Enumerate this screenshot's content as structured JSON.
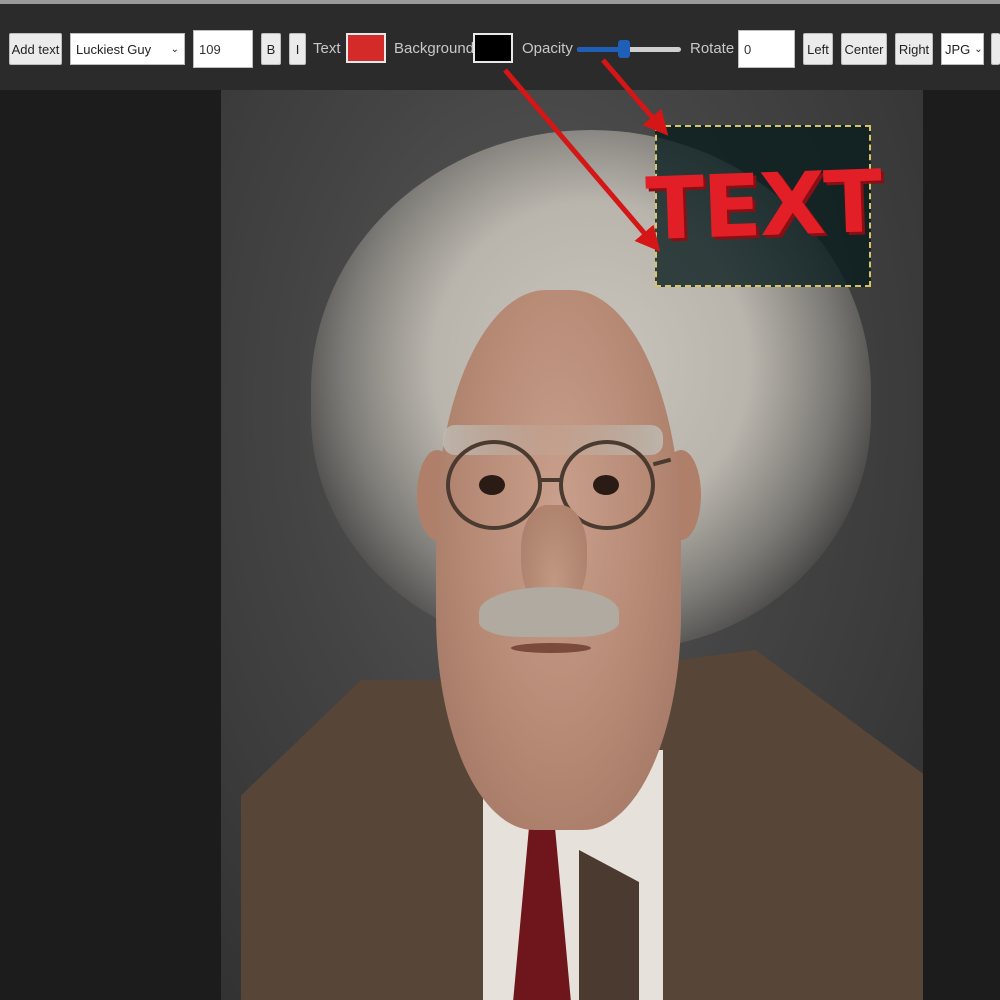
{
  "toolbar": {
    "add_text_label": "Add text",
    "font": {
      "selected": "Luckiest Guy"
    },
    "font_size": "109",
    "bold_label": "B",
    "italic_label": "I",
    "text_color_label": "Text",
    "text_color": "#d42a2a",
    "background_label": "Background",
    "background_color": "#000000",
    "opacity_label": "Opacity",
    "opacity_value": 0.45,
    "rotate_label": "Rotate",
    "rotate_value": "0",
    "align_left_label": "Left",
    "align_center_label": "Center",
    "align_right_label": "Right",
    "format": {
      "selected": "JPG"
    }
  },
  "canvas": {
    "overlay_text": "TEXT",
    "overlay_text_color": "#e21f26"
  },
  "annotations": {
    "arrow_color": "#d41616"
  }
}
